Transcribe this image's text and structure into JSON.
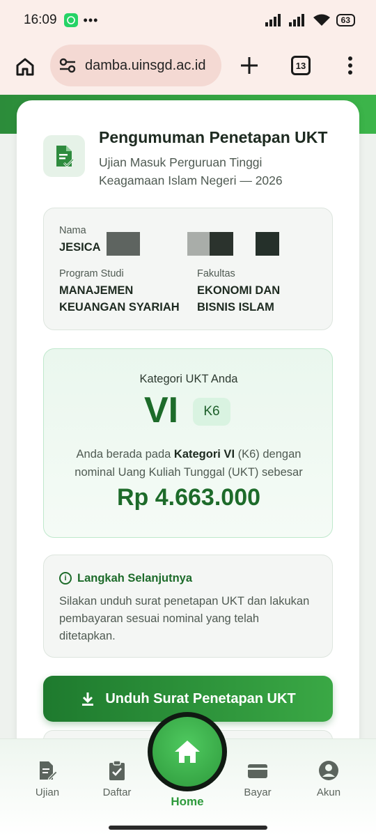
{
  "status_bar": {
    "time": "16:09",
    "battery": "63"
  },
  "browser": {
    "url": "damba.uinsgd.ac.id",
    "tab_count": "13"
  },
  "header": {
    "title": "Pengumuman Penetapan UKT",
    "subtitle": "Ujian Masuk Perguruan Tinggi Keagamaan Islam Negeri — 2026"
  },
  "student": {
    "name_label": "Nama",
    "name_value": "JESICA",
    "program_label": "Program Studi",
    "program_value": "MANAJEMEN KEUANGAN SYARIAH",
    "faculty_label": "Fakultas",
    "faculty_value": "EKONOMI DAN BISNIS ISLAM"
  },
  "category": {
    "label": "Kategori UKT Anda",
    "roman": "VI",
    "code": "K6",
    "desc_prefix": "Anda berada pada ",
    "desc_bold": "Kategori VI",
    "desc_suffix": " (K6) dengan nominal Uang Kuliah Tunggal (UKT) sebesar",
    "amount": "Rp 4.663.000"
  },
  "next_steps": {
    "title": "Langkah Selanjutnya",
    "text": "Silakan unduh surat penetapan UKT dan lakukan pembayaran sesuai nominal yang telah ditetapkan."
  },
  "download_button": {
    "label": "Unduh Surat Penetapan UKT"
  },
  "nav": {
    "items": [
      {
        "label": "Ujian"
      },
      {
        "label": "Daftar"
      },
      {
        "label": "Home"
      },
      {
        "label": "Bayar"
      },
      {
        "label": "Akun"
      }
    ]
  },
  "colors": {
    "primary": "#1d6b2a",
    "accent": "#3aa845"
  }
}
